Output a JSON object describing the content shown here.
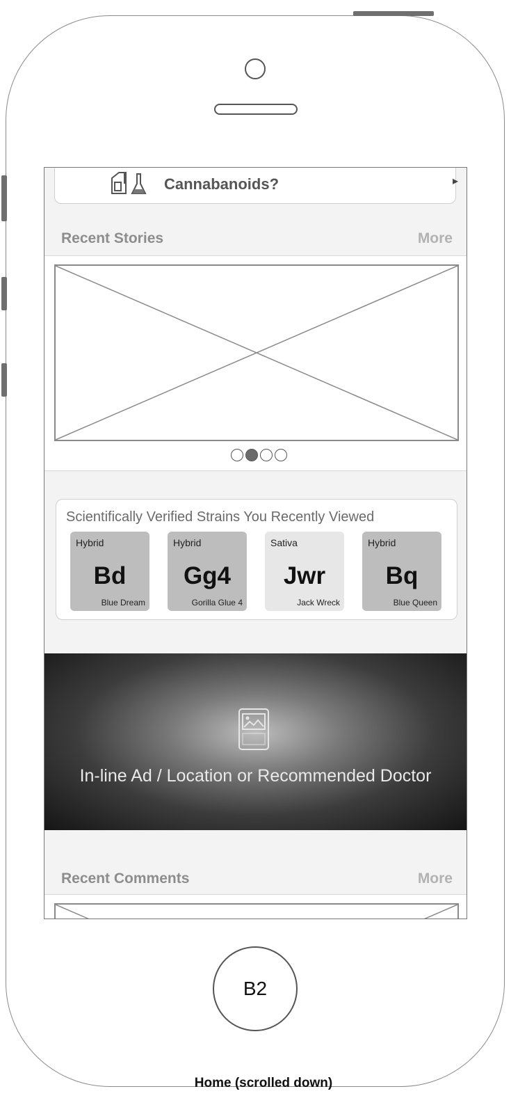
{
  "caption": "Home (scrolled down)",
  "home_button": "B2",
  "top_card": {
    "label": "Cannabanoids?"
  },
  "recent_stories": {
    "title": "Recent Stories",
    "more": "More",
    "pager_active_index": 1,
    "pager_count": 4
  },
  "strains": {
    "heading": "Scientifically Verified Strains You Recently Viewed",
    "tiles": [
      {
        "type": "Hybrid",
        "symbol": "Bd",
        "name": "Blue Dream"
      },
      {
        "type": "Hybrid",
        "symbol": "Gg4",
        "name": "Gorilla Glue 4"
      },
      {
        "type": "Sativa",
        "symbol": "Jwr",
        "name": "Jack Wreck"
      },
      {
        "type": "Hybrid",
        "symbol": "Bq",
        "name": "Blue Queen"
      }
    ]
  },
  "ad": {
    "text": "In-line Ad / Location or Recommended Doctor"
  },
  "recent_comments": {
    "title": "Recent Comments",
    "more": "More"
  }
}
